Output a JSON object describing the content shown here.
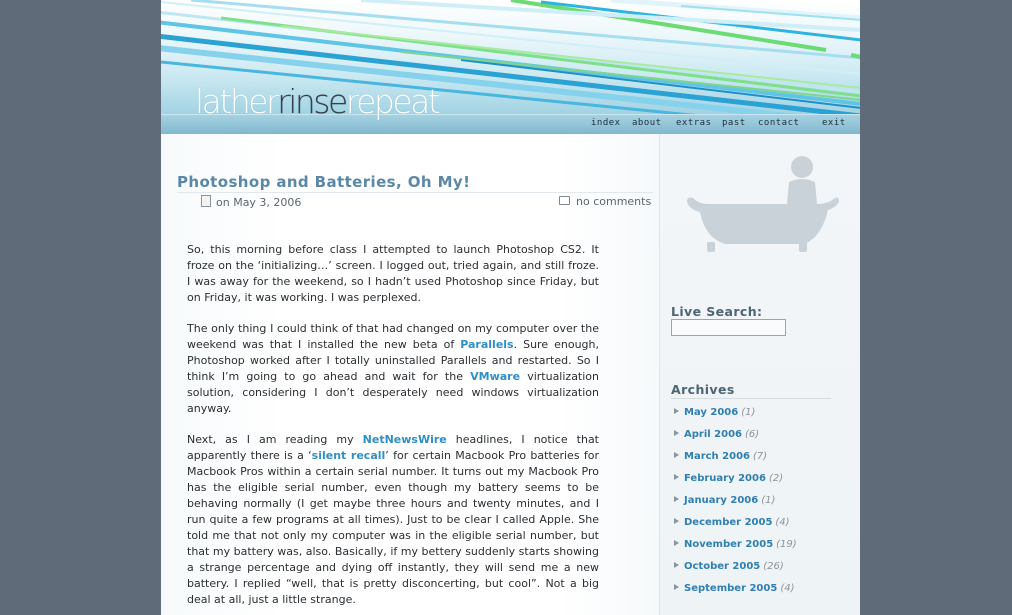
{
  "site": {
    "logo": {
      "part1": "lather",
      "part2": "rinse",
      "part3": "repeat"
    },
    "nav": [
      {
        "label": "index"
      },
      {
        "label": "about"
      },
      {
        "label": "extras"
      },
      {
        "label": "past"
      },
      {
        "label": "contact"
      },
      {
        "label": "exit"
      }
    ]
  },
  "post": {
    "title": "Photoshop and Batteries, Oh My!",
    "date": "on May 3, 2006",
    "comments": "no comments",
    "p1": "So, this morning before class I attempted to launch Photoshop CS2. It froze on the ‘initializing…’ screen. I logged out, tried again, and still froze. I was away for the weekend, so I hadn’t used Photoshop since Friday, but on Friday, it was working. I was perplexed.",
    "p2": {
      "t1": "The only thing I could think of that had changed on my computer over the weekend was that I installed the new beta of ",
      "link1": "Parallels",
      "t2": ". Sure enough, Photoshop worked after I totally uninstalled Parallels and restarted. So I think I’m going to go ahead and wait for the ",
      "link2": "VMware",
      "t3": " virtualization solution, considering I don’t desperately need windows virtualization anyway."
    },
    "p3": {
      "t1": "Next, as I am reading my ",
      "link1": "NetNewsWire",
      "t2": " headlines, I notice that apparently there is a ‘",
      "link2": "silent recall",
      "t3": "’ for certain Macbook Pro batteries for Macbook Pros within a certain serial number. It turns out my Macbook Pro has the eligible serial number, even though my battery seems to be behaving normally (I get maybe three hours and twenty minutes, and I run quite a few programs at all times). Just to be clear I called Apple. She told me that not only my computer was in the eligible serial number, but that my battery was, also. Basically, if my bettery suddenly starts showing a strange percentage and dying off instantly, they will send me a new battery. I replied “well, that is pretty disconcerting, but cool”. Not a big deal at all, just a little strange."
    }
  },
  "sidebar": {
    "search_heading": "Live Search:",
    "archives_heading": "Archives",
    "archives": [
      {
        "month": "May 2006",
        "count": "(1)"
      },
      {
        "month": "April 2006",
        "count": "(6)"
      },
      {
        "month": "March 2006",
        "count": "(7)"
      },
      {
        "month": "February 2006",
        "count": "(2)"
      },
      {
        "month": "January 2006",
        "count": "(1)"
      },
      {
        "month": "December 2005",
        "count": "(4)"
      },
      {
        "month": "November 2005",
        "count": "(19)"
      },
      {
        "month": "October 2005",
        "count": "(26)"
      },
      {
        "month": "September 2005",
        "count": "(4)"
      }
    ]
  },
  "colors": {
    "background": "#5f6b78",
    "title": "#5b88a6",
    "link": "#2f8fc6",
    "archive_link": "#2f7fb3"
  }
}
